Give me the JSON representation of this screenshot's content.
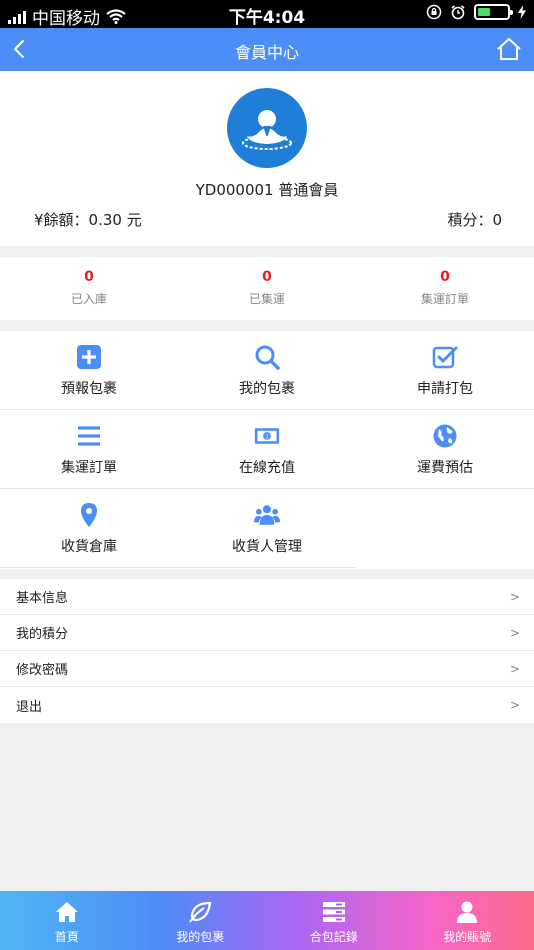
{
  "status_bar": {
    "carrier": "中国移动",
    "time": "下午4:04"
  },
  "nav": {
    "title": "會員中心"
  },
  "profile": {
    "username": "YD000001 普通會員",
    "balance": "¥餘額：0.30 元",
    "points": "積分：0"
  },
  "stats": [
    {
      "value": "0",
      "label": "已入庫"
    },
    {
      "value": "0",
      "label": "已集運"
    },
    {
      "value": "0",
      "label": "集運訂單"
    }
  ],
  "grid": [
    {
      "label": "預報包裹",
      "icon": "plus-square-icon"
    },
    {
      "label": "我的包裹",
      "icon": "search-icon"
    },
    {
      "label": "申請打包",
      "icon": "checkbox-icon"
    },
    {
      "label": "集運訂單",
      "icon": "list-icon"
    },
    {
      "label": "在線充值",
      "icon": "banknote-icon"
    },
    {
      "label": "運費預估",
      "icon": "globe-icon"
    },
    {
      "label": "收貨倉庫",
      "icon": "map-pin-icon"
    },
    {
      "label": "收貨人管理",
      "icon": "users-icon"
    }
  ],
  "menu": [
    {
      "label": "基本信息",
      "arrow": ">"
    },
    {
      "label": "我的積分",
      "arrow": ">"
    },
    {
      "label": "修改密碼",
      "arrow": ">"
    },
    {
      "label": "退出",
      "arrow": ">"
    }
  ],
  "tabs": [
    {
      "label": "首頁",
      "icon": "home-icon"
    },
    {
      "label": "我的包裹",
      "icon": "leaf-icon"
    },
    {
      "label": "合包記錄",
      "icon": "stack-icon"
    },
    {
      "label": "我的賬號",
      "icon": "user-icon"
    }
  ],
  "colors": {
    "primary": "#4c8ef7",
    "stat_number": "#e0221b",
    "avatar_bg": "#1e7ed8"
  }
}
